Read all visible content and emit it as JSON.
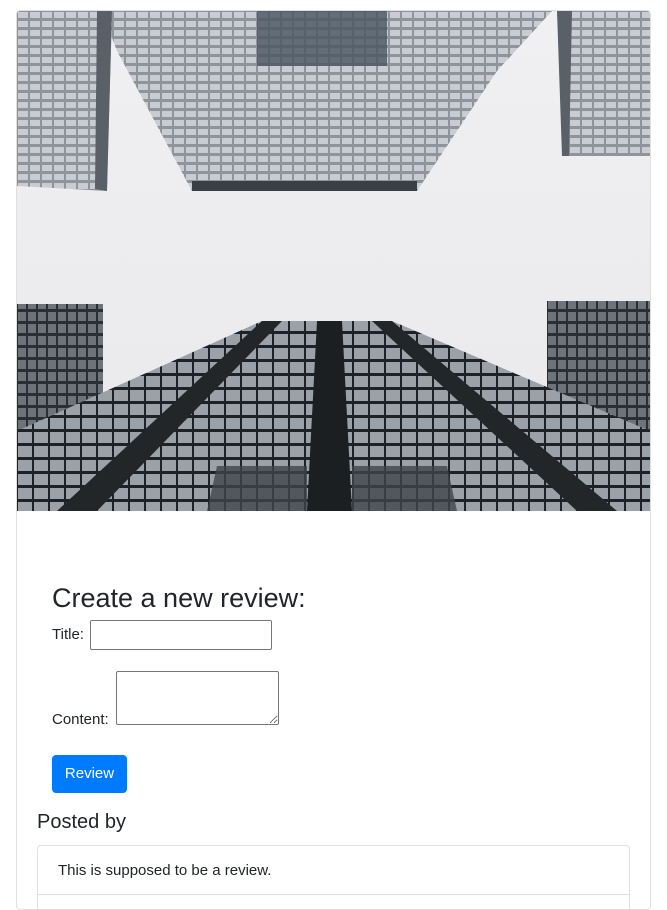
{
  "hero_image": {
    "description_icon": "building-photo"
  },
  "review_form": {
    "heading": "Create a new review:",
    "title_label": "Title:",
    "title_value": "",
    "content_label": "Content:",
    "content_value": "",
    "submit_label": "Review",
    "submit_color": "#007bff"
  },
  "reviews": {
    "posted_by_label": "Posted by",
    "items": [
      {
        "text": "This is supposed to be a review."
      }
    ]
  }
}
